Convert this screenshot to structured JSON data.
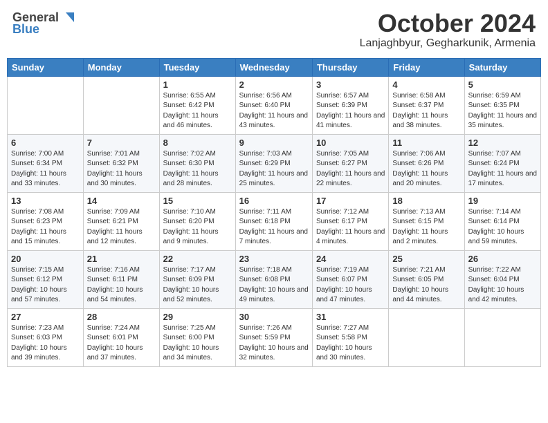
{
  "header": {
    "logo_general": "General",
    "logo_blue": "Blue",
    "month": "October 2024",
    "location": "Lanjaghbyur, Gegharkunik, Armenia"
  },
  "days_of_week": [
    "Sunday",
    "Monday",
    "Tuesday",
    "Wednesday",
    "Thursday",
    "Friday",
    "Saturday"
  ],
  "weeks": [
    [
      {
        "day": "",
        "sunrise": "",
        "sunset": "",
        "daylight": ""
      },
      {
        "day": "",
        "sunrise": "",
        "sunset": "",
        "daylight": ""
      },
      {
        "day": "1",
        "sunrise": "Sunrise: 6:55 AM",
        "sunset": "Sunset: 6:42 PM",
        "daylight": "Daylight: 11 hours and 46 minutes."
      },
      {
        "day": "2",
        "sunrise": "Sunrise: 6:56 AM",
        "sunset": "Sunset: 6:40 PM",
        "daylight": "Daylight: 11 hours and 43 minutes."
      },
      {
        "day": "3",
        "sunrise": "Sunrise: 6:57 AM",
        "sunset": "Sunset: 6:39 PM",
        "daylight": "Daylight: 11 hours and 41 minutes."
      },
      {
        "day": "4",
        "sunrise": "Sunrise: 6:58 AM",
        "sunset": "Sunset: 6:37 PM",
        "daylight": "Daylight: 11 hours and 38 minutes."
      },
      {
        "day": "5",
        "sunrise": "Sunrise: 6:59 AM",
        "sunset": "Sunset: 6:35 PM",
        "daylight": "Daylight: 11 hours and 35 minutes."
      }
    ],
    [
      {
        "day": "6",
        "sunrise": "Sunrise: 7:00 AM",
        "sunset": "Sunset: 6:34 PM",
        "daylight": "Daylight: 11 hours and 33 minutes."
      },
      {
        "day": "7",
        "sunrise": "Sunrise: 7:01 AM",
        "sunset": "Sunset: 6:32 PM",
        "daylight": "Daylight: 11 hours and 30 minutes."
      },
      {
        "day": "8",
        "sunrise": "Sunrise: 7:02 AM",
        "sunset": "Sunset: 6:30 PM",
        "daylight": "Daylight: 11 hours and 28 minutes."
      },
      {
        "day": "9",
        "sunrise": "Sunrise: 7:03 AM",
        "sunset": "Sunset: 6:29 PM",
        "daylight": "Daylight: 11 hours and 25 minutes."
      },
      {
        "day": "10",
        "sunrise": "Sunrise: 7:05 AM",
        "sunset": "Sunset: 6:27 PM",
        "daylight": "Daylight: 11 hours and 22 minutes."
      },
      {
        "day": "11",
        "sunrise": "Sunrise: 7:06 AM",
        "sunset": "Sunset: 6:26 PM",
        "daylight": "Daylight: 11 hours and 20 minutes."
      },
      {
        "day": "12",
        "sunrise": "Sunrise: 7:07 AM",
        "sunset": "Sunset: 6:24 PM",
        "daylight": "Daylight: 11 hours and 17 minutes."
      }
    ],
    [
      {
        "day": "13",
        "sunrise": "Sunrise: 7:08 AM",
        "sunset": "Sunset: 6:23 PM",
        "daylight": "Daylight: 11 hours and 15 minutes."
      },
      {
        "day": "14",
        "sunrise": "Sunrise: 7:09 AM",
        "sunset": "Sunset: 6:21 PM",
        "daylight": "Daylight: 11 hours and 12 minutes."
      },
      {
        "day": "15",
        "sunrise": "Sunrise: 7:10 AM",
        "sunset": "Sunset: 6:20 PM",
        "daylight": "Daylight: 11 hours and 9 minutes."
      },
      {
        "day": "16",
        "sunrise": "Sunrise: 7:11 AM",
        "sunset": "Sunset: 6:18 PM",
        "daylight": "Daylight: 11 hours and 7 minutes."
      },
      {
        "day": "17",
        "sunrise": "Sunrise: 7:12 AM",
        "sunset": "Sunset: 6:17 PM",
        "daylight": "Daylight: 11 hours and 4 minutes."
      },
      {
        "day": "18",
        "sunrise": "Sunrise: 7:13 AM",
        "sunset": "Sunset: 6:15 PM",
        "daylight": "Daylight: 11 hours and 2 minutes."
      },
      {
        "day": "19",
        "sunrise": "Sunrise: 7:14 AM",
        "sunset": "Sunset: 6:14 PM",
        "daylight": "Daylight: 10 hours and 59 minutes."
      }
    ],
    [
      {
        "day": "20",
        "sunrise": "Sunrise: 7:15 AM",
        "sunset": "Sunset: 6:12 PM",
        "daylight": "Daylight: 10 hours and 57 minutes."
      },
      {
        "day": "21",
        "sunrise": "Sunrise: 7:16 AM",
        "sunset": "Sunset: 6:11 PM",
        "daylight": "Daylight: 10 hours and 54 minutes."
      },
      {
        "day": "22",
        "sunrise": "Sunrise: 7:17 AM",
        "sunset": "Sunset: 6:09 PM",
        "daylight": "Daylight: 10 hours and 52 minutes."
      },
      {
        "day": "23",
        "sunrise": "Sunrise: 7:18 AM",
        "sunset": "Sunset: 6:08 PM",
        "daylight": "Daylight: 10 hours and 49 minutes."
      },
      {
        "day": "24",
        "sunrise": "Sunrise: 7:19 AM",
        "sunset": "Sunset: 6:07 PM",
        "daylight": "Daylight: 10 hours and 47 minutes."
      },
      {
        "day": "25",
        "sunrise": "Sunrise: 7:21 AM",
        "sunset": "Sunset: 6:05 PM",
        "daylight": "Daylight: 10 hours and 44 minutes."
      },
      {
        "day": "26",
        "sunrise": "Sunrise: 7:22 AM",
        "sunset": "Sunset: 6:04 PM",
        "daylight": "Daylight: 10 hours and 42 minutes."
      }
    ],
    [
      {
        "day": "27",
        "sunrise": "Sunrise: 7:23 AM",
        "sunset": "Sunset: 6:03 PM",
        "daylight": "Daylight: 10 hours and 39 minutes."
      },
      {
        "day": "28",
        "sunrise": "Sunrise: 7:24 AM",
        "sunset": "Sunset: 6:01 PM",
        "daylight": "Daylight: 10 hours and 37 minutes."
      },
      {
        "day": "29",
        "sunrise": "Sunrise: 7:25 AM",
        "sunset": "Sunset: 6:00 PM",
        "daylight": "Daylight: 10 hours and 34 minutes."
      },
      {
        "day": "30",
        "sunrise": "Sunrise: 7:26 AM",
        "sunset": "Sunset: 5:59 PM",
        "daylight": "Daylight: 10 hours and 32 minutes."
      },
      {
        "day": "31",
        "sunrise": "Sunrise: 7:27 AM",
        "sunset": "Sunset: 5:58 PM",
        "daylight": "Daylight: 10 hours and 30 minutes."
      },
      {
        "day": "",
        "sunrise": "",
        "sunset": "",
        "daylight": ""
      },
      {
        "day": "",
        "sunrise": "",
        "sunset": "",
        "daylight": ""
      }
    ]
  ]
}
